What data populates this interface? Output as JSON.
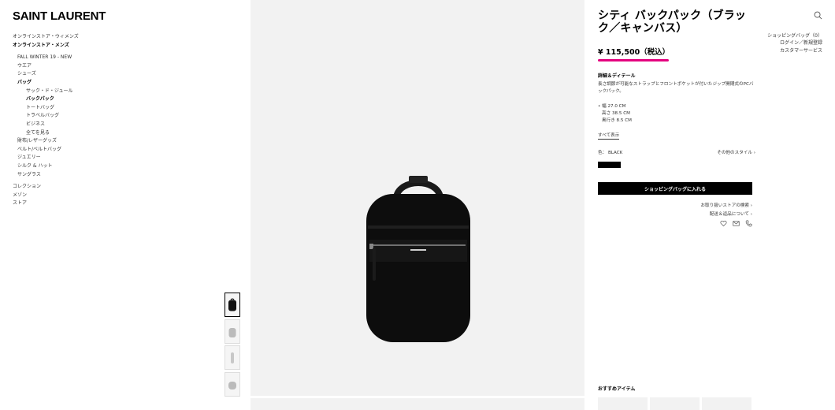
{
  "brand": {
    "logo": "SAINT LAURENT"
  },
  "nav": {
    "items": [
      {
        "label": "オンラインストア・ウィメンズ",
        "level": 0,
        "bold": false
      },
      {
        "label": "オンラインストア・メンズ",
        "level": 0,
        "bold": true
      },
      {
        "label": "FALL WINTER 19 - NEW",
        "level": 1,
        "bold": false
      },
      {
        "label": "ウエア",
        "level": 1,
        "bold": false
      },
      {
        "label": "シューズ",
        "level": 1,
        "bold": false
      },
      {
        "label": "バッグ",
        "level": 1,
        "bold": true
      },
      {
        "label": "サック・ド・ジュール",
        "level": 2,
        "bold": false
      },
      {
        "label": "バックパック",
        "level": 2,
        "bold": true
      },
      {
        "label": "トートバッグ",
        "level": 2,
        "bold": false
      },
      {
        "label": "トラベルバッグ",
        "level": 2,
        "bold": false
      },
      {
        "label": "ビジネス",
        "level": 2,
        "bold": false
      },
      {
        "label": "全てを見る",
        "level": 2,
        "bold": false
      },
      {
        "label": "財布/レザーグッズ",
        "level": 1,
        "bold": false
      },
      {
        "label": "ベルト/ベルトバッグ",
        "level": 1,
        "bold": false
      },
      {
        "label": "ジュエリー",
        "level": 1,
        "bold": false
      },
      {
        "label": "シルク & ハット",
        "level": 1,
        "bold": false
      },
      {
        "label": "サングラス",
        "level": 1,
        "bold": false
      }
    ],
    "footer": [
      "コレクション",
      "メゾン",
      "ストア"
    ]
  },
  "product": {
    "title": "シティ バックパック（ブラック／キャンバス）",
    "price": "¥  115,500（税込）",
    "details_heading": "詳細＆ディテール",
    "description": "長さ調節が可能なストラップとフロントポケットが付いたジップ開閉式のPCバックパック。",
    "dimensions": [
      "• 幅 27.0 CM",
      "高さ 38.5 CM",
      "奥行き 8.5 CM"
    ],
    "show_all": "すべて表示",
    "color_label": "色： BLACK",
    "other_styles": "その他のスタイル ›",
    "add_to_bag": "ショッピングバッグに入れる",
    "store_search": "お取り扱いストアの検索 ›",
    "shipping_returns": "配送＆返品について ›"
  },
  "icons": [
    "search-icon",
    "heart-icon",
    "mail-icon",
    "phone-icon",
    "backpack-icon"
  ],
  "account": {
    "bag": "ショッピングバッグ（0）",
    "login": "ログイン／新規登録",
    "support": "カスタマーサービス"
  },
  "recommended": {
    "title": "おすすめアイテム"
  },
  "colors": {
    "accent": "#e4007f",
    "gallery_bg": "#f2f2f2",
    "button_bg": "#000000"
  }
}
